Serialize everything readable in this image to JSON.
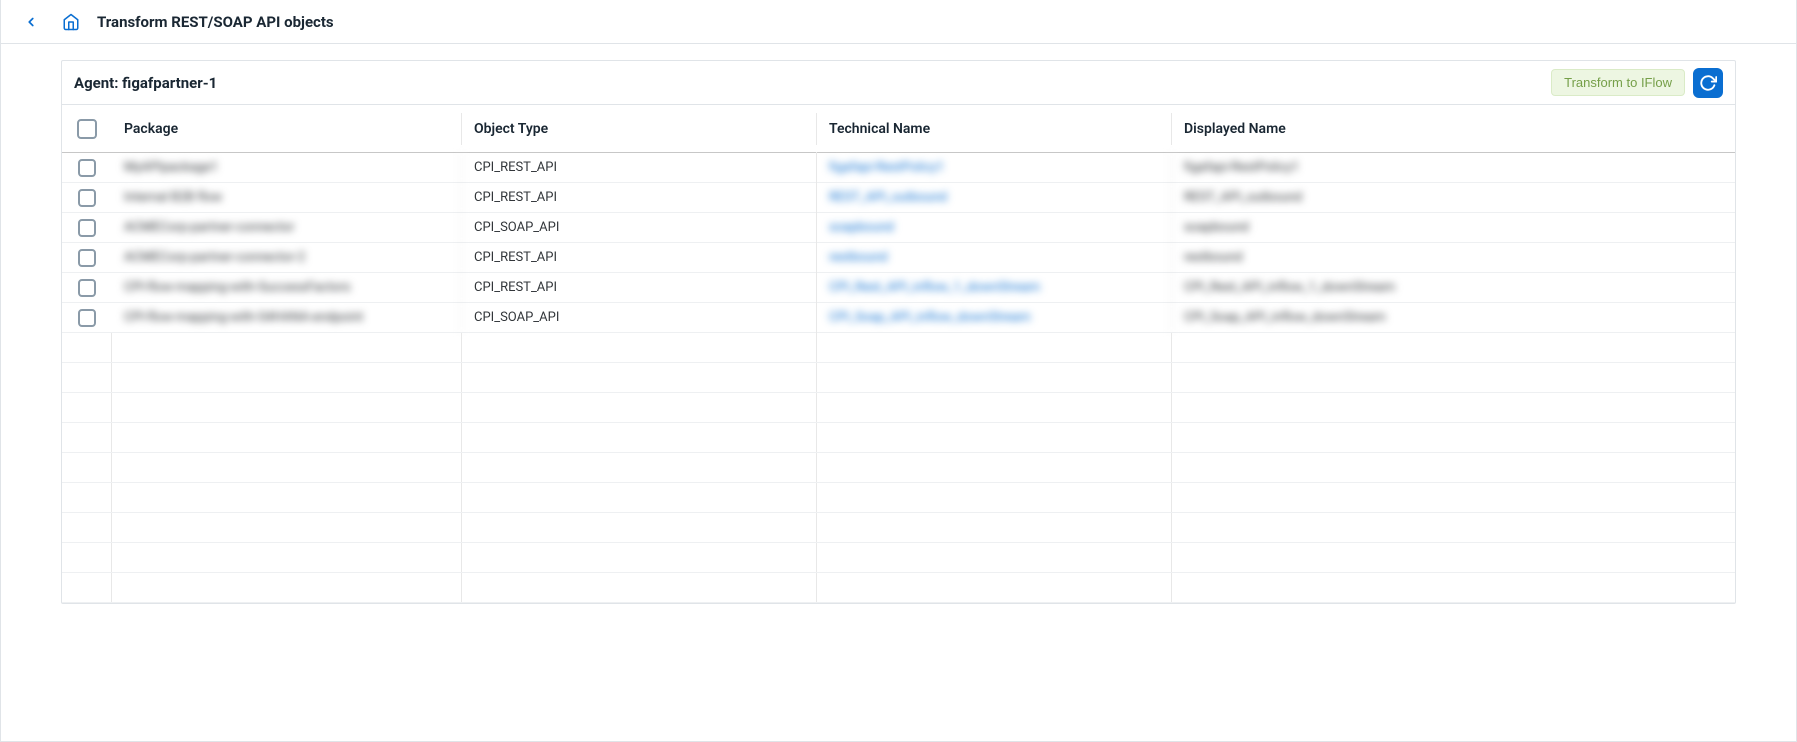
{
  "header": {
    "title": "Transform REST/SOAP API objects"
  },
  "panel": {
    "agent_label": "Agent: figafpartner-1",
    "transform_btn": "Transform to IFlow"
  },
  "table": {
    "columns": {
      "package": "Package",
      "object_type": "Object Type",
      "technical_name": "Technical Name",
      "displayed_name": "Displayed Name"
    },
    "rows": [
      {
        "package": "MyAPIpackage1",
        "object_type": "CPI_REST_API",
        "technical_name": "figafapi-RestPolicy1",
        "displayed_name": "figafapi-RestPolicy1"
      },
      {
        "package": "Internal B2B flow",
        "object_type": "CPI_REST_API",
        "technical_name": "REST_API_outbound",
        "displayed_name": "REST_API_outbound"
      },
      {
        "package": "ACMECorp-partner-connector",
        "object_type": "CPI_SOAP_API",
        "technical_name": "soapbound",
        "displayed_name": "soapbound"
      },
      {
        "package": "ACMECorp-partner-connector-2",
        "object_type": "CPI_REST_API",
        "technical_name": "restbound",
        "displayed_name": "restbound"
      },
      {
        "package": "CPI-flow-mapping-with-SuccessFactors",
        "object_type": "CPI_REST_API",
        "technical_name": "CPI_Rest_API_inflow_1_downStream",
        "displayed_name": "CPI_Rest_API_inflow_1_downStream"
      },
      {
        "package": "CPI-flow-mapping-with-S4HANA-endpoint",
        "object_type": "CPI_SOAP_API",
        "technical_name": "CPI_Soap_API_inflow_downStream",
        "displayed_name": "CPI_Soap_API_inflow_downStream"
      }
    ],
    "empty_rows": 9
  }
}
